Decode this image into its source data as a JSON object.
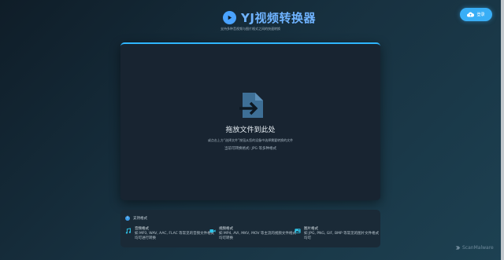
{
  "header": {
    "app_title": "YJ视频转换器",
    "subtitle": "支持多种音视频与图片格式之间的快速转换"
  },
  "login": {
    "label": "登录"
  },
  "upload": {
    "title": "拖放文件到此处",
    "hint": "或点击上方“选择文件”按钮从您的设备中选择需要转换的文件",
    "note": "当前可转换格式: JPG 等多种格式"
  },
  "formats": {
    "heading": "支持格式",
    "items": [
      {
        "icon": "music-icon",
        "name": "音频格式",
        "desc": "如 MP3, WAV, AAC, FLAC 等常见的音频文件格式",
        "desc2": "均可进行转换"
      },
      {
        "icon": "video-camera-icon",
        "name": "视频格式",
        "desc": "如 MP4, AVI, MKV, MOV 等主流的视频文件格式",
        "desc2": "均可转换"
      },
      {
        "icon": "image-icon",
        "name": "图片格式",
        "desc": "如 JPG, PNG, GIF, BMP 等常见的图片文件格式",
        "desc2": "均可"
      }
    ]
  },
  "watermark": {
    "text": "ScanMalware"
  },
  "colors": {
    "accent": "#39aef6",
    "panel": "#182431",
    "panel_border": "#2fb6ff",
    "icon_fg": "#3e6f96"
  }
}
